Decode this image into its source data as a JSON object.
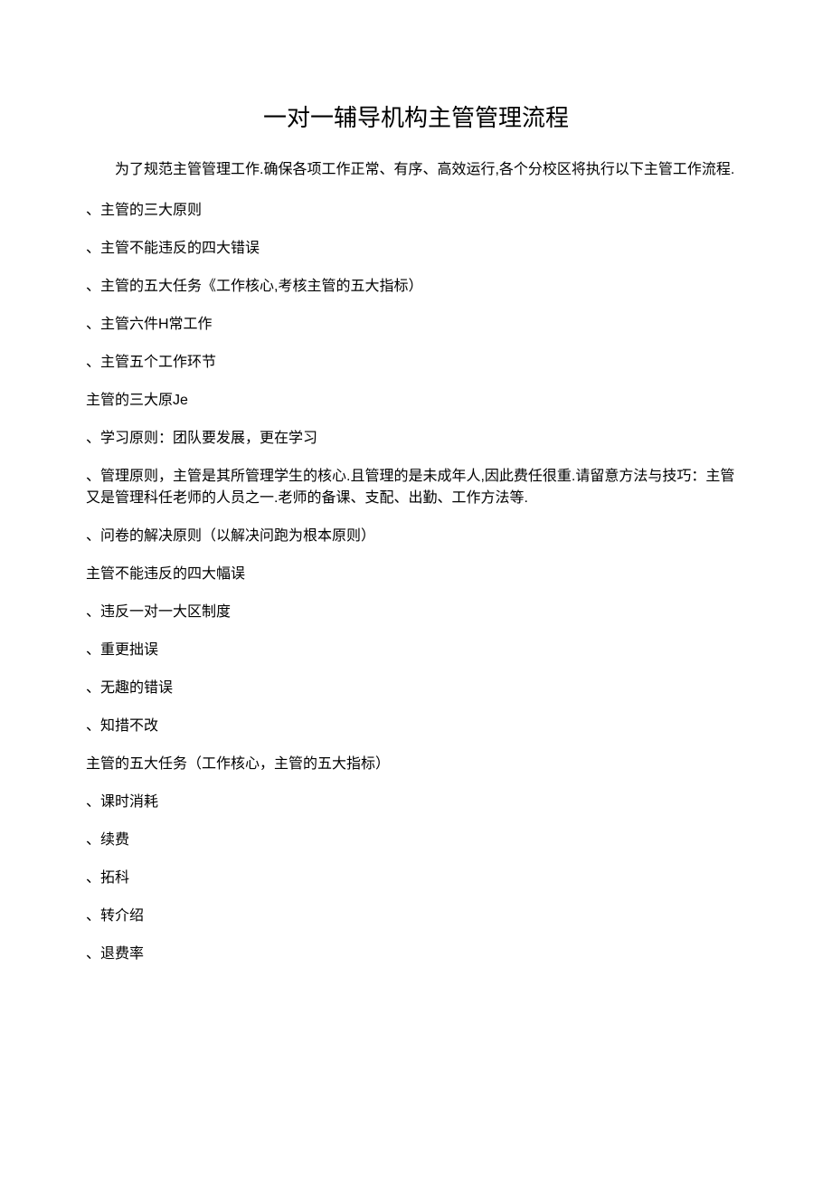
{
  "title": "一对一辅导机构主管管理流程",
  "intro": "为了规范主管管理工作.确保各项工作正常、有序、高效运行,各个分校区将执行以下主管工作流程.",
  "outline": [
    "、主管的三大原则",
    "、主管不能违反的四大错误",
    "、主管的五大任务《工作核心,考核主管的五大指标）",
    "、主管六件H常工作",
    "、主管五个工作环节"
  ],
  "section1": {
    "header": "主管的三大原Je",
    "items": [
      "、学习原则：团队要发展，更在学习",
      "、管理原则，主管是其所管理学生的核心.且管理的是未成年人,因此费任很重.请留意方法与技巧：主管又是管理科任老师的人员之一.老师的备课、支配、出勤、工作方法等.",
      "、问卷的解决原则（以解决问跑为根本原则）"
    ]
  },
  "section2": {
    "header": "主管不能违反的四大幅误",
    "items": [
      "、违反一对一大区制度",
      "、重更拙误",
      "、无趣的错误",
      "、知措不改"
    ]
  },
  "section3": {
    "header": "主管的五大任务（工作核心，主管的五大指标）",
    "items": [
      "、课时消耗",
      "、续费",
      "、拓科",
      "、转介绍",
      "、退费率"
    ]
  }
}
